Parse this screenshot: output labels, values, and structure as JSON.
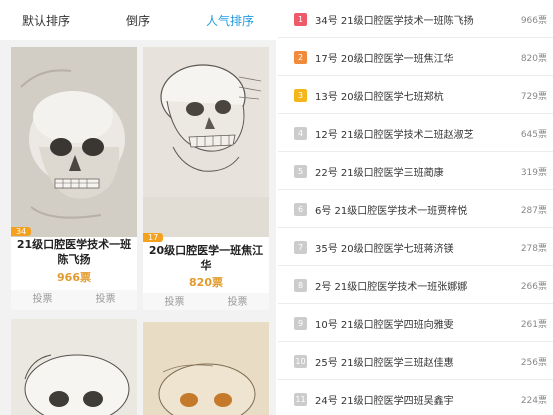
{
  "sort_tabs": [
    {
      "label": "默认排序",
      "active": false
    },
    {
      "label": "倒序",
      "active": false
    },
    {
      "label": "人气排序",
      "active": true
    }
  ],
  "cards": [
    {
      "rank_badge": "34",
      "title_line1": "21级口腔医学技术一班",
      "title_line2": "陈飞扬",
      "votes": "966票",
      "vote_btn": "投票",
      "vote_btn2": "投票"
    },
    {
      "rank_badge": "17",
      "title_line1": "20级口腔医学一班焦江",
      "title_line2": "华",
      "votes": "820票",
      "vote_btn": "投票",
      "vote_btn2": "投票"
    },
    {
      "rank_badge": "",
      "title_line1": "",
      "title_line2": "",
      "votes": "",
      "vote_btn": "",
      "vote_btn2": ""
    },
    {
      "rank_badge": "",
      "title_line1": "",
      "title_line2": "",
      "votes": "",
      "vote_btn": "",
      "vote_btn2": ""
    }
  ],
  "rankings": [
    {
      "pos": "1",
      "label": "34号 21级口腔医学技术一班陈飞扬",
      "votes": "966票",
      "color": "#ef5a6a"
    },
    {
      "pos": "2",
      "label": "17号 20级口腔医学一班焦江华",
      "votes": "820票",
      "color": "#f28a3c"
    },
    {
      "pos": "3",
      "label": "13号 20级口腔医学七班郑杭",
      "votes": "729票",
      "color": "#f5b61c"
    },
    {
      "pos": "4",
      "label": "12号 21级口腔医学技术二班赵淑芝",
      "votes": "645票",
      "color": "#cccccc"
    },
    {
      "pos": "5",
      "label": "22号 21级口腔医学三班蔺康",
      "votes": "319票",
      "color": "#cccccc"
    },
    {
      "pos": "6",
      "label": "6号 21级口腔医学技术一班贾梓悦",
      "votes": "287票",
      "color": "#cccccc"
    },
    {
      "pos": "7",
      "label": "35号 20级口腔医学七班蒋济镁",
      "votes": "278票",
      "color": "#cccccc"
    },
    {
      "pos": "8",
      "label": "2号 21级口腔医学技术一班张娜娜",
      "votes": "266票",
      "color": "#cccccc"
    },
    {
      "pos": "9",
      "label": "10号 21级口腔医学四班向雅雯",
      "votes": "261票",
      "color": "#cccccc"
    },
    {
      "pos": "10",
      "label": "25号 21级口腔医学三班赵佳惠",
      "votes": "256票",
      "color": "#cccccc"
    },
    {
      "pos": "11",
      "label": "24号 21级口腔医学四班吴鑫宇",
      "votes": "224票",
      "color": "#cccccc"
    }
  ]
}
